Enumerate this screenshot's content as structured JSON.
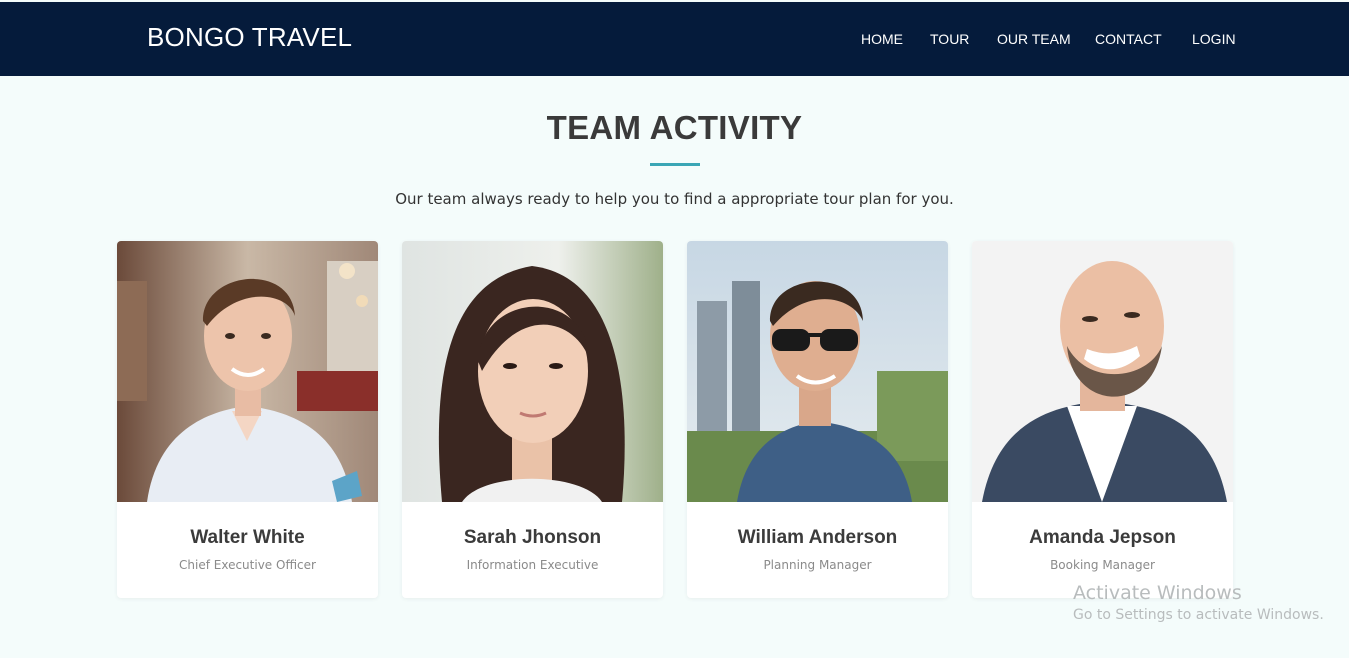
{
  "header": {
    "brand": "BONGO TRAVEL",
    "nav": [
      "HOME",
      "TOUR",
      "OUR TEAM",
      "CONTACT",
      "LOGIN"
    ]
  },
  "section": {
    "title": "TEAM ACTIVITY",
    "subtitle": "Our team always ready to help you to find a appropriate tour plan for you."
  },
  "team": [
    {
      "name": "Walter White",
      "role": "Chief Executive Officer"
    },
    {
      "name": "Sarah Jhonson",
      "role": "Information Executive"
    },
    {
      "name": "William Anderson",
      "role": "Planning Manager"
    },
    {
      "name": "Amanda Jepson",
      "role": "Booking Manager"
    }
  ],
  "watermark": {
    "title": "Activate Windows",
    "subtitle": "Go to Settings to activate Windows."
  },
  "colors": {
    "navbar": "#051b3b",
    "background": "#f4fcfb",
    "accent": "#3aa6b5"
  }
}
